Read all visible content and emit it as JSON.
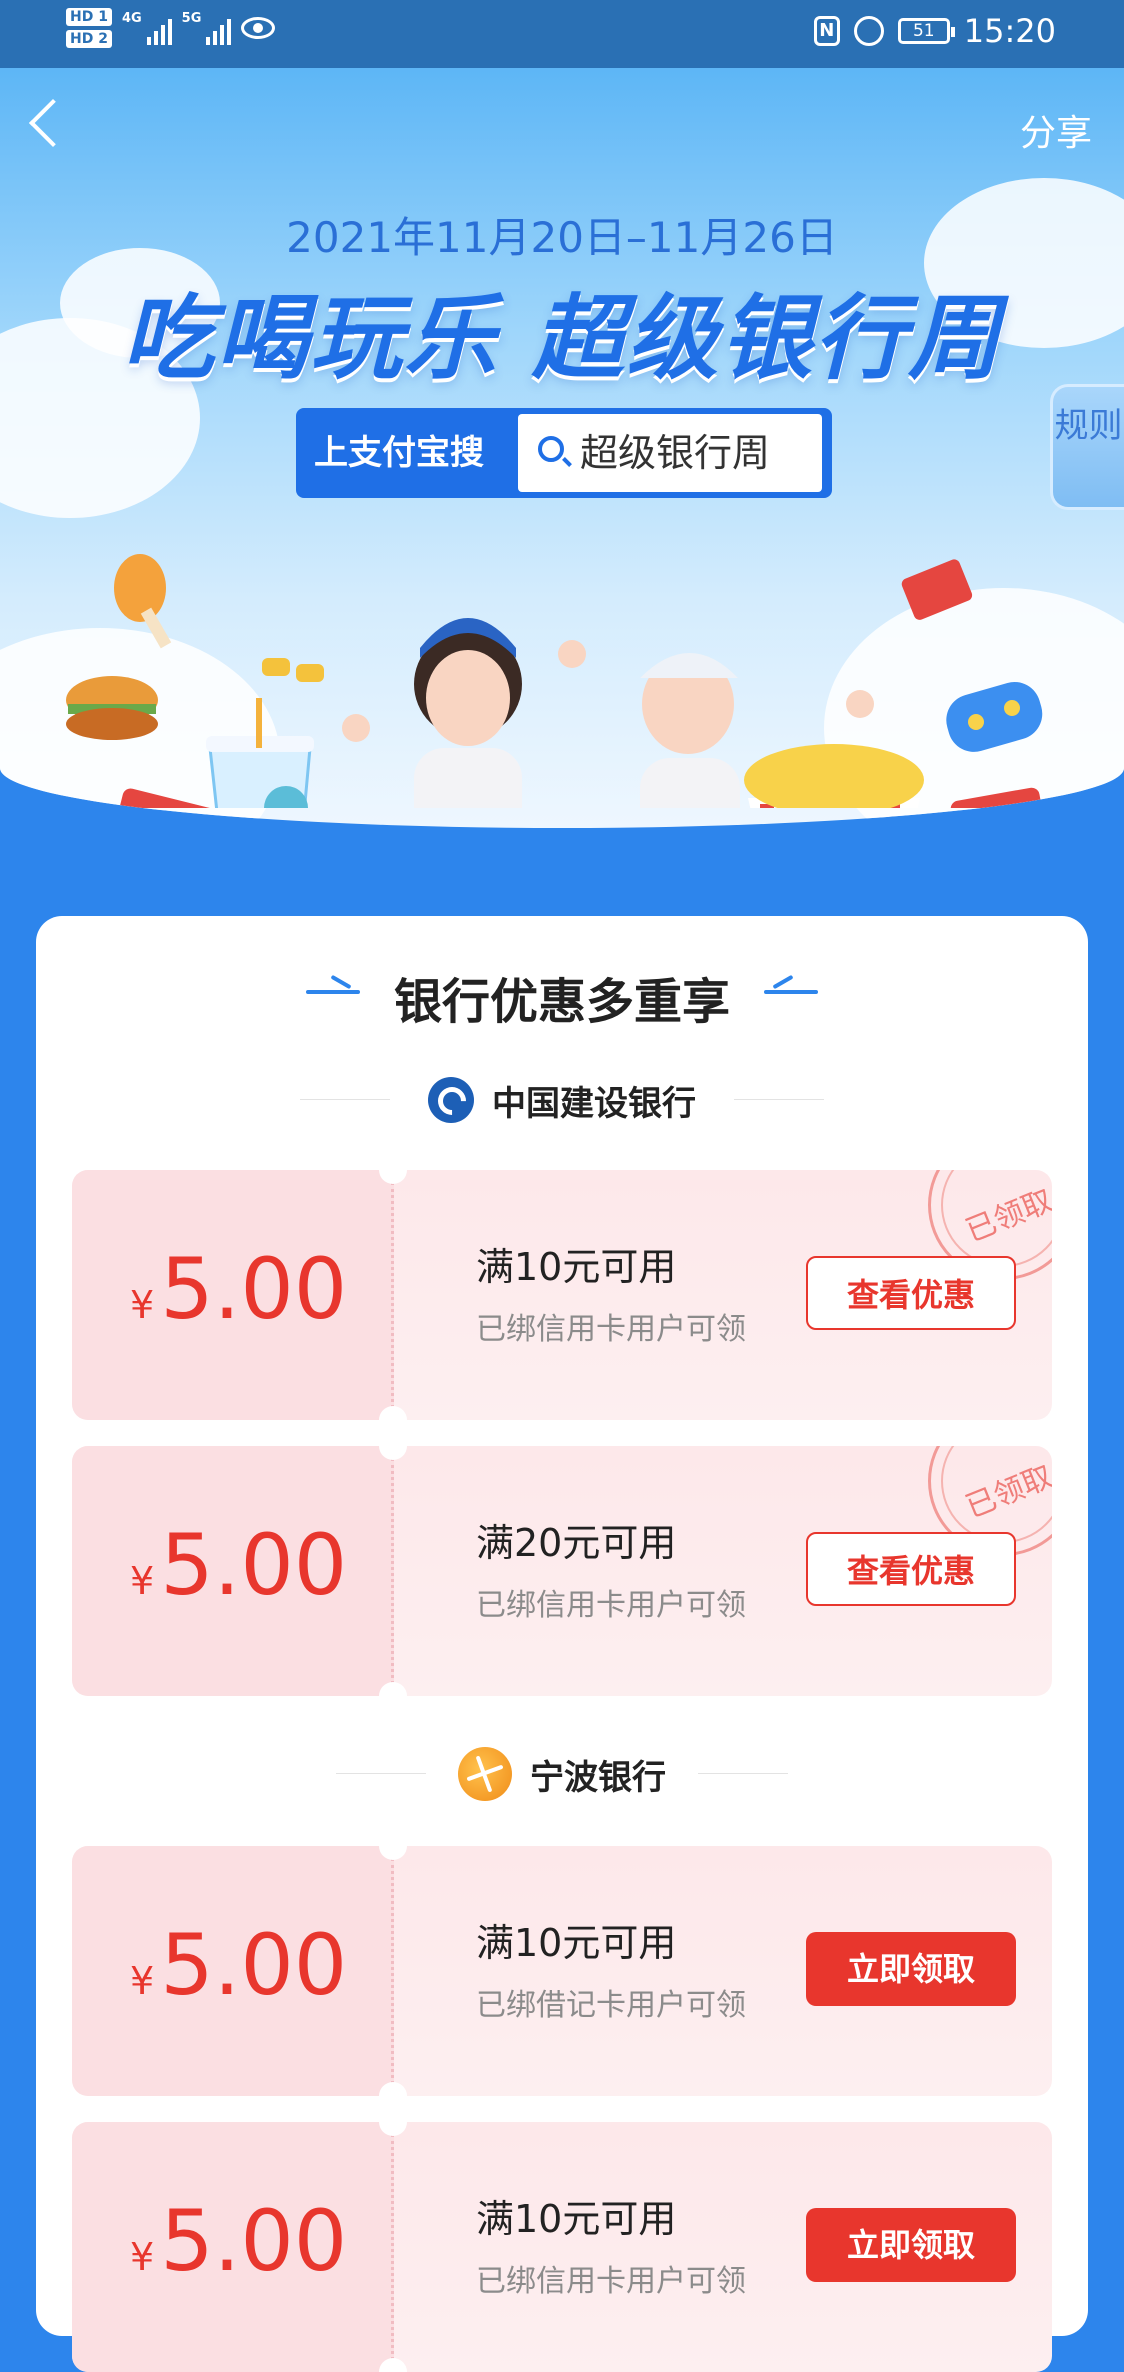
{
  "status_bar": {
    "hd1": "HD 1",
    "hd2": "HD 2",
    "net1": "4G",
    "net2": "5G",
    "nfc": "N",
    "battery": "51",
    "time": "15:20"
  },
  "header": {
    "share_label": "分享",
    "rules_label": "规则"
  },
  "hero": {
    "date_range": "2021年11月20日–11月26日",
    "title": "吃喝玩乐 超级银行周",
    "search_prefix": "上支付宝搜",
    "search_keyword": "超级银行周"
  },
  "section": {
    "title": "银行优惠多重享"
  },
  "banks": [
    {
      "name": "中国建设银行",
      "coupons": [
        {
          "currency": "¥",
          "amount": "5.00",
          "condition": "满10元可用",
          "requirement": "已绑信用卡用户可领",
          "button": "查看优惠",
          "stamp": "已领取"
        },
        {
          "currency": "¥",
          "amount": "5.00",
          "condition": "满20元可用",
          "requirement": "已绑信用卡用户可领",
          "button": "查看优惠",
          "stamp": "已领取"
        }
      ]
    },
    {
      "name": "宁波银行",
      "coupons": [
        {
          "currency": "¥",
          "amount": "5.00",
          "condition": "满10元可用",
          "requirement": "已绑借记卡用户可领",
          "button": "立即领取"
        },
        {
          "currency": "¥",
          "amount": "5.00",
          "condition": "满10元可用",
          "requirement": "已绑信用卡用户可领",
          "button": "立即领取"
        }
      ]
    }
  ],
  "colors": {
    "brand_blue": "#2d85ec",
    "accent_red": "#e8362d",
    "coupon_bg": "#fde8ea"
  }
}
